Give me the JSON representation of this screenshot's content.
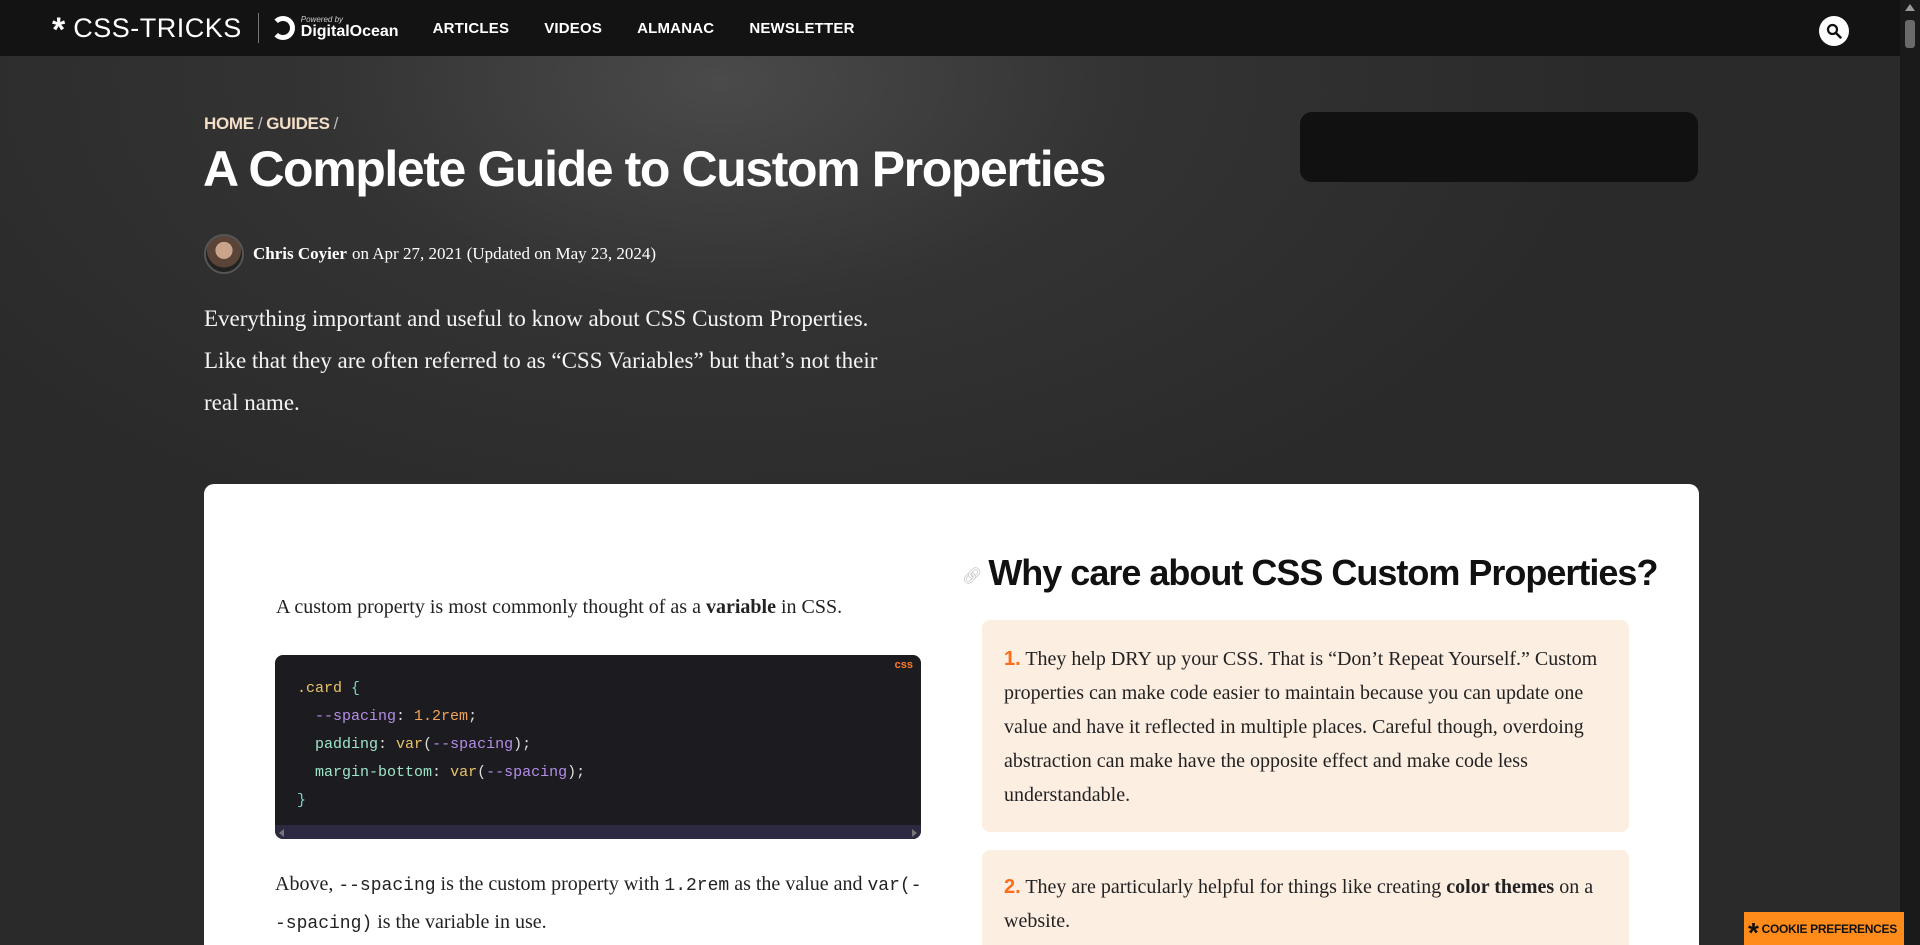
{
  "header": {
    "logo_star": "*",
    "logo_text": "CSS-TRICKS",
    "sponsor_small": "Powered by",
    "sponsor_name": "DigitalOcean",
    "nav": [
      "ARTICLES",
      "VIDEOS",
      "ALMANAC",
      "NEWSLETTER"
    ],
    "search_icon": "search-icon"
  },
  "breadcrumb": {
    "items": [
      "HOME",
      "GUIDES"
    ],
    "separator": "/"
  },
  "article": {
    "title": "A Complete Guide to Custom Properties",
    "author": "Chris Coyier",
    "date_text": "on Apr 27, 2021 (Updated on May 23, 2024)",
    "intro": "Everything important and useful to know about CSS Custom Properties. Like that they are often referred to as “CSS Variables” but that’s not their real name."
  },
  "body": {
    "p1_before": "A custom property is most commonly thought of as a",
    "p1_bold": "variable",
    "p1_after": "in CSS.",
    "code_lang": "css",
    "code": {
      "selector": ".card",
      "open": "{",
      "close": "}",
      "l2_var": "--spacing",
      "l2_val": "1.2rem",
      "l3_prop": "padding",
      "l4_prop": "margin-bottom",
      "fn": "var",
      "fn_arg": "--spacing"
    },
    "p2_a": "Above,",
    "p2_code1": "--spacing",
    "p2_b": "is the custom property with",
    "p2_code2": "1.2rem",
    "p2_c": "as the value and",
    "p2_code3": "var(--spacing)",
    "p2_d": "is the variable in use."
  },
  "why": {
    "heading": "Why care about CSS Custom Properties?",
    "item1_num": "1.",
    "item1_text": "They help DRY up your CSS. That is “Don’t Repeat Yourself.” Custom properties can make code easier to maintain because you can update one value and have it reflected in multiple places. Careful though, overdoing abstraction can make have the opposite effect and make code less understandable.",
    "item2_num": "2.",
    "item2_before": "They are particularly helpful for things like creating",
    "item2_bold": "color themes",
    "item2_after": "on a website."
  },
  "cookie": {
    "star": "*",
    "label": "COOKIE PREFERENCES"
  },
  "colors": {
    "accent": "#ff6b17",
    "callout_bg": "#fdeee2",
    "code_bg": "#1c1b1f",
    "nav_bg": "#131313"
  }
}
